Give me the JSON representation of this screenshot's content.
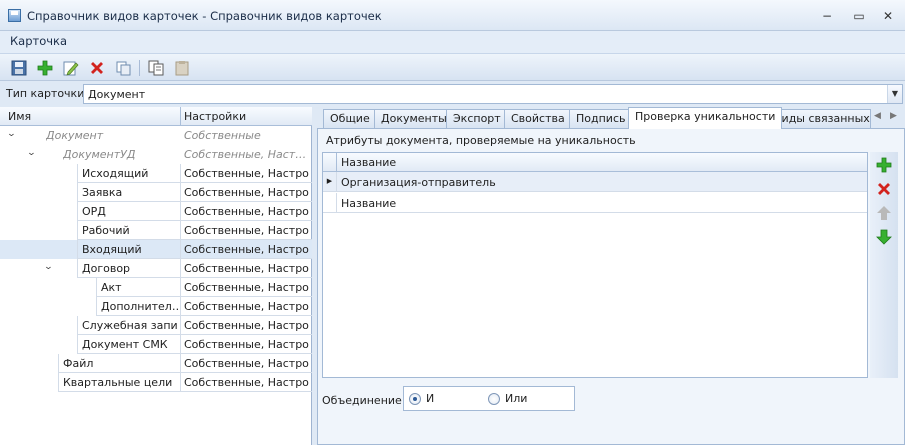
{
  "window": {
    "title": "Справочник видов карточек - Справочник видов карточек",
    "minimize": "−",
    "restore": "▭",
    "close": "✕"
  },
  "menu": {
    "items": [
      "Карточка"
    ]
  },
  "toolbar": {
    "icons": [
      "save-icon",
      "add-icon",
      "edit-icon",
      "delete-icon",
      "copy-icon",
      "duplicate-icon",
      "paste-icon"
    ]
  },
  "card_type": {
    "label": "Тип карточки:",
    "value": "Документ"
  },
  "tree": {
    "columns": [
      "Имя",
      "Настройки"
    ],
    "rows": [
      {
        "name": "Документ",
        "settings": "Собственные",
        "level": 0,
        "expanded": true,
        "inherited": true
      },
      {
        "name": "ДокументУД",
        "settings": "Собственные, Наст…",
        "level": 1,
        "expanded": true,
        "inherited": true
      },
      {
        "name": "Исходящий",
        "settings": "Собственные, Настро…",
        "level": 2
      },
      {
        "name": "Заявка",
        "settings": "Собственные, Настро…",
        "level": 2
      },
      {
        "name": "ОРД",
        "settings": "Собственные, Настро…",
        "level": 2
      },
      {
        "name": "Рабочий",
        "settings": "Собственные, Настро…",
        "level": 2
      },
      {
        "name": "Входящий",
        "settings": "Собственные, Настро…",
        "level": 2,
        "selected": true
      },
      {
        "name": "Договор",
        "settings": "Собственные, Настро…",
        "level": 2,
        "expanded": true
      },
      {
        "name": "Акт",
        "settings": "Собственные, Настро…",
        "level": 3
      },
      {
        "name": "Дополнител…",
        "settings": "Собственные, Настро…",
        "level": 3
      },
      {
        "name": "Служебная запи…",
        "settings": "Собственные, Настро…",
        "level": 2
      },
      {
        "name": "Документ СМК",
        "settings": "Собственные, Настро…",
        "level": 2
      },
      {
        "name": "Файл",
        "settings": "Собственные, Настро…",
        "level": 1
      },
      {
        "name": "Квартальные цели",
        "settings": "Собственные, Настро…",
        "level": 1
      }
    ]
  },
  "tabs": {
    "items": [
      "Общие",
      "Документы",
      "Экспорт",
      "Свойства",
      "Подпись",
      "Проверка уникальности",
      "Виды связанных з"
    ],
    "active": 5
  },
  "uniqueness": {
    "caption": "Атрибуты документа, проверяемые на уникальность",
    "column": "Название",
    "rows": [
      "Организация-отправитель",
      "Название"
    ],
    "side_icons": [
      "add-icon",
      "remove-icon",
      "move-up-icon",
      "move-down-icon"
    ]
  },
  "union": {
    "label": "Объединение:",
    "options": [
      {
        "label": "И",
        "checked": true
      },
      {
        "label": "Или",
        "checked": false
      }
    ]
  }
}
